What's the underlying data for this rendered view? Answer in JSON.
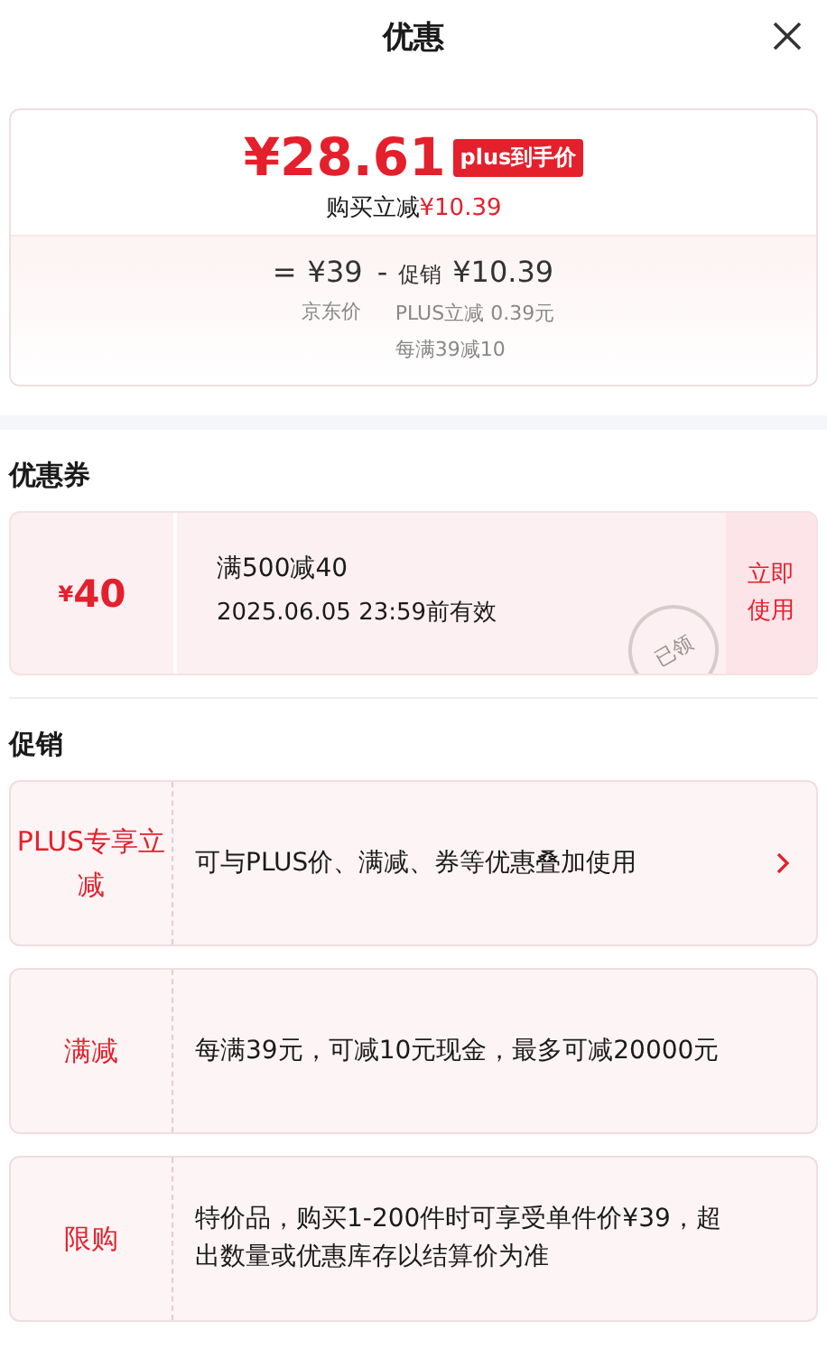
{
  "header": {
    "title": "优惠"
  },
  "price_card": {
    "price": "¥28.61",
    "badge": "plus到手价",
    "saving_label": "购买立减",
    "saving_amount": "¥10.39",
    "breakdown": [
      {
        "sign": "=",
        "value": "¥39",
        "notes": [
          "京东价"
        ]
      },
      {
        "sign": "-",
        "label": "促销",
        "value": "¥10.39",
        "notes": [
          "PLUS立减 0.39元",
          "每满39减10"
        ]
      }
    ]
  },
  "coupons": {
    "title": "优惠券",
    "items": [
      {
        "currency": "¥",
        "amount": "40",
        "condition": "满500减40",
        "validity": "2025.06.05 23:59前有效",
        "stamp": "已领",
        "action": "立即使用"
      }
    ]
  },
  "promotions": {
    "title": "促销",
    "items": [
      {
        "label": "PLUS专享立减",
        "description": "可与PLUS价、满减、券等优惠叠加使用",
        "arrow": true
      },
      {
        "label": "满减",
        "description": "每满39元，可减10元现金，最多可减20000元",
        "arrow": false
      },
      {
        "label": "限购",
        "description": "特价品，购买1-200件时可享受单件价¥39，超出数量或优惠库存以结算价为准",
        "arrow": false
      }
    ]
  }
}
